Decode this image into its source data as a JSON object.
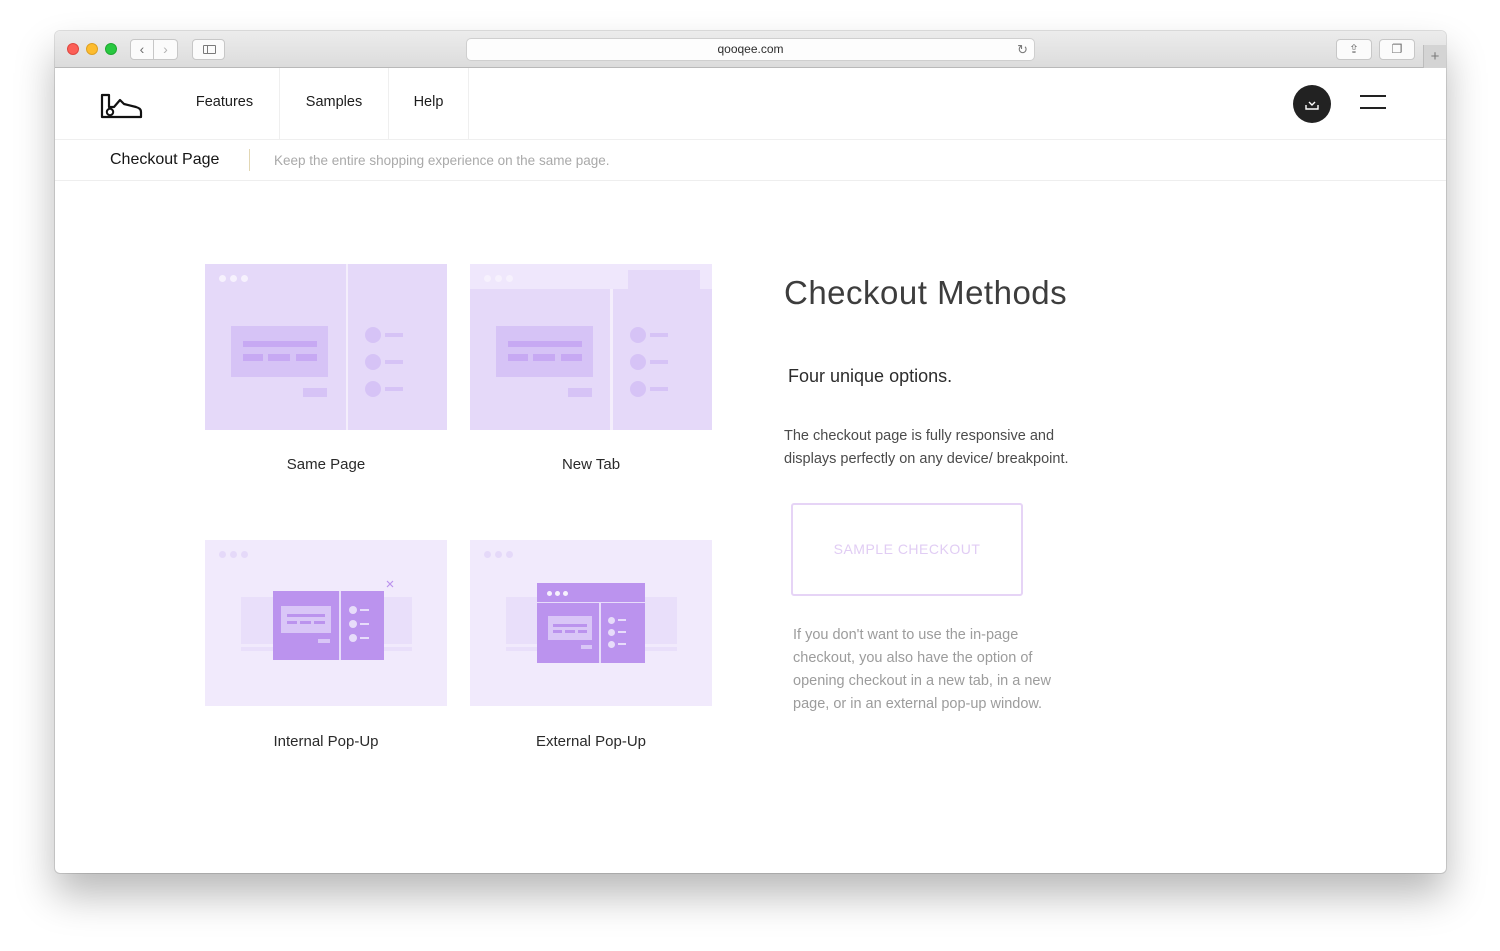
{
  "browser": {
    "url": "qooqee.com",
    "back_glyph": "‹",
    "forward_glyph": "›",
    "reload_glyph": "↻",
    "share_glyph": "⇪",
    "tabs_glyph": "❐",
    "newtab_glyph": "+"
  },
  "header": {
    "nav": [
      "Features",
      "Samples",
      "Help"
    ],
    "logo_icon": "sneaker-icon",
    "cart_icon": "inbox-download-icon",
    "menu_icon": "hamburger-icon"
  },
  "subheader": {
    "title": "Checkout Page",
    "tagline": "Keep the entire shopping experience on the same page."
  },
  "methods": [
    {
      "label": "Same Page"
    },
    {
      "label": "New Tab"
    },
    {
      "label": "Internal Pop-Up"
    },
    {
      "label": "External Pop-Up"
    }
  ],
  "right": {
    "heading": "Checkout Methods",
    "subheading": "Four unique options.",
    "description": "The checkout page is fully responsive and displays perfectly on any device/ breakpoint.",
    "button_label": "SAMPLE CHECKOUT",
    "note": "If you don't want to use the in-page checkout, you also have the option of opening checkout in a new tab, in a new page, or in an external pop-up window."
  },
  "colors": {
    "accent_lavender": "#e5d9f9",
    "accent_purple": "#bb93ee",
    "button_border": "#e6d4f6"
  }
}
